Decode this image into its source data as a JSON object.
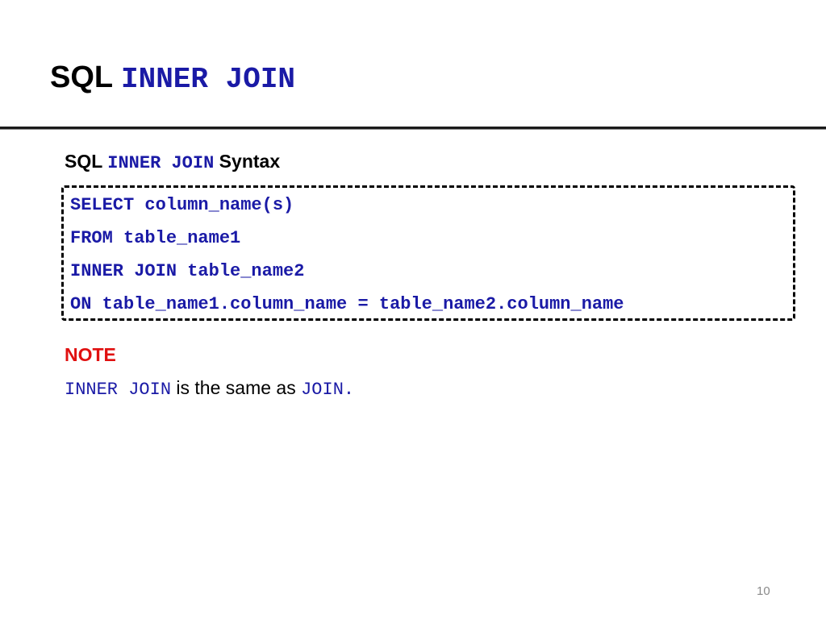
{
  "title": {
    "prefix": "SQL ",
    "keyword": "INNER JOIN"
  },
  "subheading": {
    "prefix": "SQL ",
    "keyword": "INNER JOIN",
    "suffix": " Syntax"
  },
  "code": {
    "lines": [
      "SELECT column_name(s)",
      "FROM table_name1",
      "INNER JOIN table_name2",
      "ON table_name1.column_name = table_name2.column_name"
    ]
  },
  "note": {
    "label": "NOTE",
    "keyword_a": "INNER JOIN",
    "middle": " is the same as ",
    "keyword_b": "JOIN."
  },
  "page_number": "10",
  "colors": {
    "code_blue": "#1a1aa6",
    "note_red": "#e01010",
    "page_number_gray": "#8a8a8a"
  }
}
